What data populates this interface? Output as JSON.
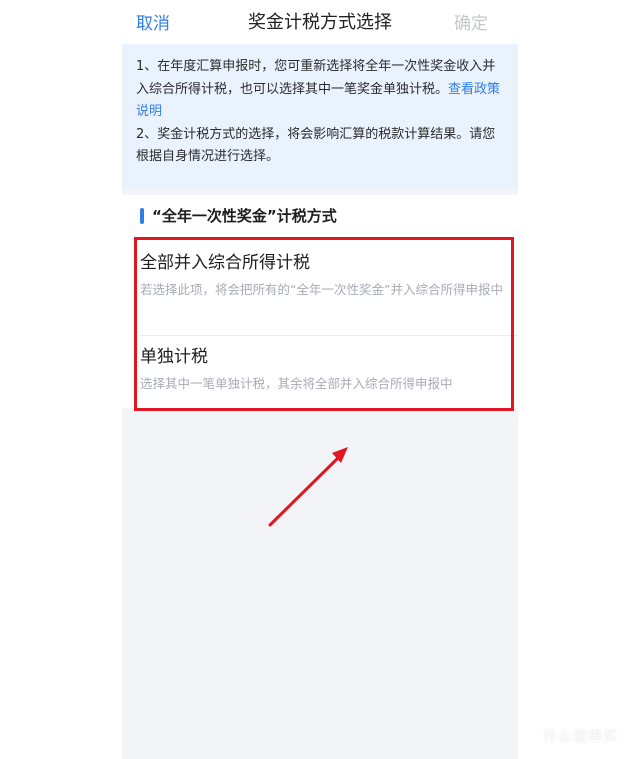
{
  "nav": {
    "cancel": "取消",
    "title": "奖金计税方式选择",
    "confirm": "确定"
  },
  "notice": {
    "line1": "1、在年度汇算申报时，您可重新选择将全年一次性奖金收入并入综合所得计税，也可以选择其中一笔奖金单独计税。",
    "policy_link": "查看政策说明",
    "line2": "2、奖金计税方式的选择，将会影响汇算的税款计算结果。请您根据自身情况进行选择。"
  },
  "section": {
    "title": "“全年一次性奖金”计税方式"
  },
  "options": [
    {
      "title": "全部并入综合所得计税",
      "desc": "若选择此项，将会把所有的“全年一次性奖金”并入综合所得申报中"
    },
    {
      "title": "单独计税",
      "desc": "选择其中一笔单独计税，其余将全部并入综合所得申报中"
    }
  ],
  "annotation": {
    "color": "#e1161e"
  },
  "watermark": "什么值得买",
  "colors": {
    "accent": "#2f7ee6",
    "disabled": "#c3c7cf",
    "notice_bg": "#eaf2fd",
    "page_bg": "#f3f4f8"
  }
}
